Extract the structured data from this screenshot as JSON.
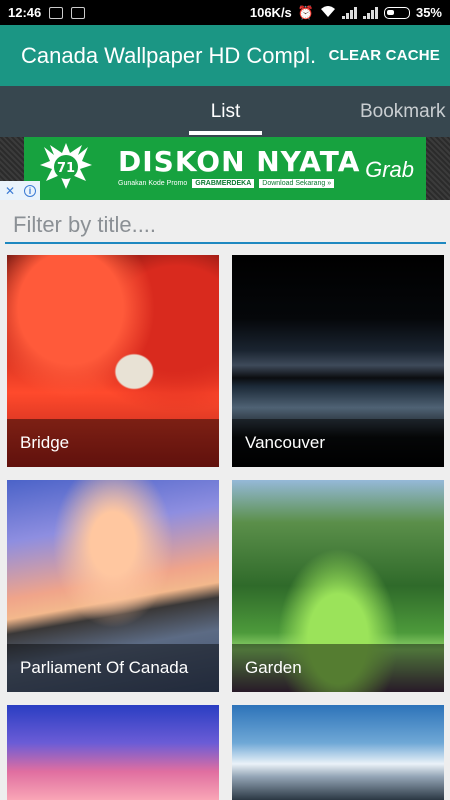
{
  "status_bar": {
    "time": "12:46",
    "net_speed": "106K/s",
    "battery": "35%"
  },
  "app_bar": {
    "title": "Canada Wallpaper HD Compl..",
    "action": "CLEAR CACHE"
  },
  "tabs": [
    {
      "label": "List",
      "selected": true
    },
    {
      "label": "Bookmark",
      "selected": false
    }
  ],
  "ad": {
    "headline": "DISKON NYATA",
    "promo_text": "Gunakan Kode Promo",
    "promo_code": "GRABMERDEKA",
    "cta": "Download Sekarang »",
    "brand": "Grab",
    "mascot_text": "71"
  },
  "filter": {
    "placeholder": "Filter by title...."
  },
  "wallpapers": [
    {
      "title": "Bridge"
    },
    {
      "title": "Vancouver"
    },
    {
      "title": "Parliament Of Canada"
    },
    {
      "title": "Garden"
    },
    {
      "title": ""
    },
    {
      "title": ""
    }
  ],
  "colors": {
    "primary": "#1b9684",
    "tab_bar": "#37474f",
    "accent_underline": "#1e88c0"
  }
}
